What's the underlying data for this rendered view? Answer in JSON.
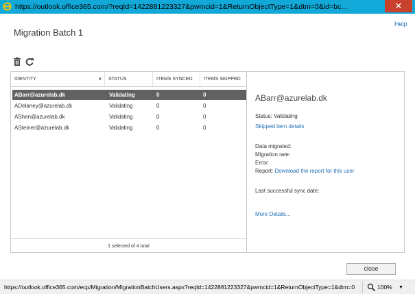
{
  "window": {
    "title": "https://outlook.office365.com/?reqId=1422881223327&pwmcid=1&ReturnObjectType=1&dtm=0&id=bc...",
    "close_glyph": "✕",
    "accent": "#12a9d8",
    "close_color": "#c7412c"
  },
  "help_label": "Help",
  "page_title": "Migration Batch 1",
  "toolbar": {
    "delete_icon": "trash-icon",
    "refresh_icon": "refresh-icon"
  },
  "grid": {
    "columns": {
      "identity": "IDENTITY",
      "status": "STATUS",
      "synced": "ITEMS SYNCED",
      "skipped": "ITEMS SKIPPED"
    },
    "sort_indicator": "▲",
    "rows": [
      {
        "identity": "ABarr@azurelab.dk",
        "status": "Validating",
        "synced": "0",
        "skipped": "0",
        "selected": true
      },
      {
        "identity": "ADelaney@azurelab.dk",
        "status": "Validating",
        "synced": "0",
        "skipped": "0",
        "selected": false
      },
      {
        "identity": "AShen@azurelab.dk",
        "status": "Validating",
        "synced": "0",
        "skipped": "0",
        "selected": false
      },
      {
        "identity": "ASteiner@azurelab.dk",
        "status": "Validating",
        "synced": "0",
        "skipped": "0",
        "selected": false
      }
    ],
    "footer": "1 selected of 4 total",
    "selected_row_color": "#616161"
  },
  "details": {
    "name": "ABarr@azurelab.dk",
    "status_line": "Status: Validating",
    "skipped_link": "Skipped item details",
    "data_migrated": "Data migrated:",
    "migration_rate": "Migration rate:",
    "error": "Error:",
    "report_label": "Report:",
    "report_link": "Download the report for this user",
    "last_sync": "Last successful sync date:",
    "more_details": "More Details..."
  },
  "close_label": "close",
  "statusbar": {
    "url": "https://outlook.office365.com/ecp/Migration/MigrationBatchUsers.aspx?reqId=1422881223327&pwmcid=1&ReturnObjectType=1&dtm=0",
    "zoom": "100%",
    "zoom_caret": "▼"
  },
  "link_color": "#1f6eb5"
}
